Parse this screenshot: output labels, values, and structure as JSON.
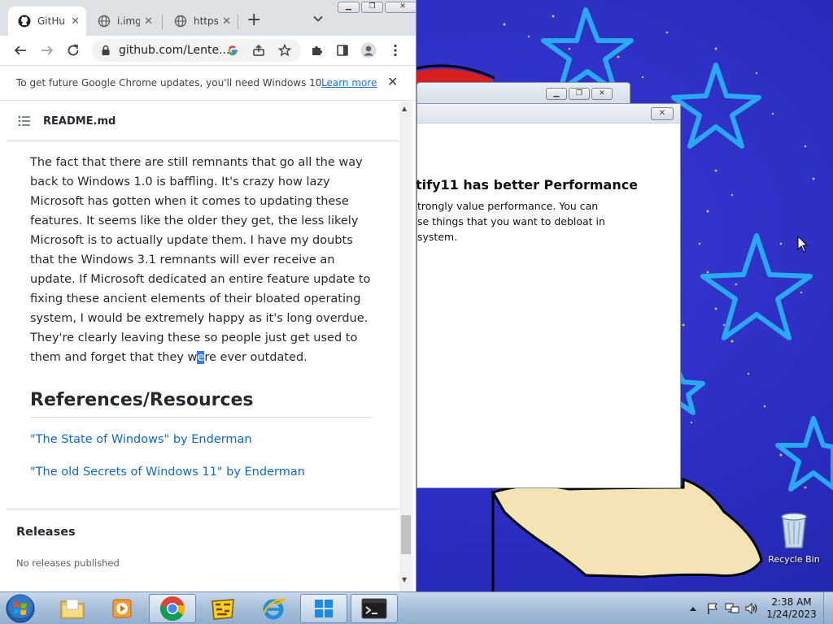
{
  "chrome": {
    "tabs": [
      {
        "title": "GitHub",
        "active": true
      },
      {
        "title": "i.imgur",
        "active": false
      },
      {
        "title": "https",
        "active": false
      }
    ],
    "new_tab_glyph": "+",
    "window_buttons": [
      "minimize",
      "maximize",
      "close"
    ],
    "url": "github.com/Lente...",
    "infobar": {
      "message": "To get future Google Chrome updates, you'll need Windows 10...",
      "link": "Learn more"
    }
  },
  "readme": {
    "file_name": "README.md",
    "paragraph_before": "The fact that there are still remnants that go all the way back to Windows 1.0 is baffling. It's crazy how lazy Microsoft has gotten when it comes to updating these features. It seems like the older they get, the less likely Microsoft is to actually update them. I have my doubts that the Windows 3.1 remnants will ever receive an update. If Microsoft dedicated an entire feature update to fixing these ancient elements of their bloated operating system, I would be extremely happy as it's long overdue. They're clearly leaving these so people just get used to them and forget that they w",
    "paragraph_selected": "e",
    "paragraph_after": "re ever outdated.",
    "references_heading": "References/Resources",
    "references": [
      "\"The State of Windows\" by Enderman",
      "\"The old Secrets of Windows 11\" by Enderman"
    ]
  },
  "sidebar": {
    "releases_title": "Releases",
    "releases_empty": "No releases published"
  },
  "winaero": {
    "heading": "tify11 has better Performance",
    "body": "trongly value performance. You can se things that you want to debloat in system."
  },
  "desktop": {
    "recycle_bin_label": "Recycle Bin"
  },
  "taskbar": {
    "apps": [
      "explorer",
      "media-player",
      "chrome",
      "game",
      "internet-explorer",
      "windows-app",
      "terminal"
    ],
    "active_app": "chrome",
    "time": "2:38 AM",
    "date": "1/24/2023"
  }
}
